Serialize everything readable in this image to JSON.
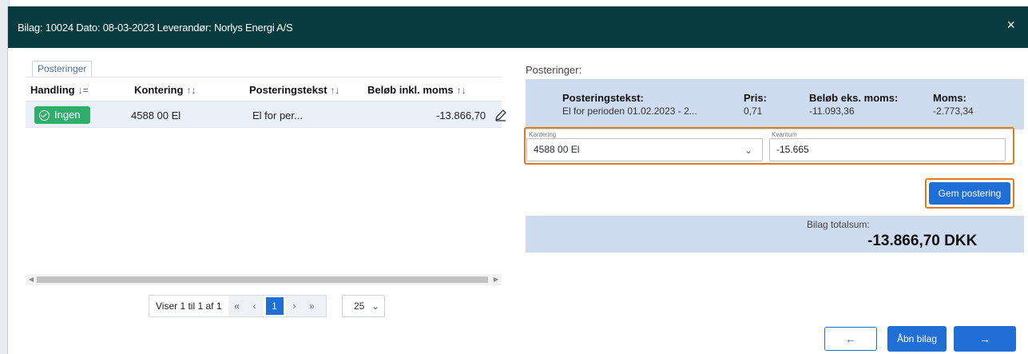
{
  "header": {
    "title": "Bilag: 10024 Dato: 08-03-2023 Leverandør: Norlys Energi A/S",
    "close_glyph": "×"
  },
  "left": {
    "tab_label": "Posteringer",
    "columns": {
      "handling": "Handling",
      "handling_sort": "↓=",
      "kontering": "Kontering",
      "kontering_sort": "↑↓",
      "posteringstekst": "Posteringstekst",
      "posteringstekst_sort": "↑↓",
      "belob": "Beløb inkl. moms",
      "belob_sort": "↑↓"
    },
    "rows": [
      {
        "status": "Ingen",
        "kontering": "4588 00 El",
        "posteringstekst": "El for per...",
        "belob": "-13.866,70"
      }
    ],
    "pager": {
      "info": "Viser 1 til 1 af 1",
      "first": "«",
      "prev": "‹",
      "current": "1",
      "next": "›",
      "last": "»",
      "page_size": "25"
    }
  },
  "right": {
    "title": "Posteringer:",
    "summary": {
      "posteringstekst_label": "Posteringstekst:",
      "posteringstekst_value": "El for perioden 01.02.2023 - 2...",
      "pris_label": "Pris:",
      "pris_value": "0,71",
      "belob_eks_label": "Beløb eks. moms:",
      "belob_eks_value": "-11.093,36",
      "moms_label": "Moms:",
      "moms_value": "-2.773,34"
    },
    "form": {
      "kontering_label": "Kontering",
      "kontering_value": "4588 00 El",
      "kvantum_label": "Kvantum",
      "kvantum_value": "-15.665"
    },
    "save_label": "Gem postering",
    "total_label": "Bilag totalsum:",
    "total_value": "-13.866,70 DKK"
  },
  "footer": {
    "prev_glyph": "←",
    "open_label": "Åbn bilag",
    "next_glyph": "→"
  },
  "colors": {
    "header_bg": "#063b40",
    "accent_blue": "#1f6fd6",
    "status_green": "#2fae6b",
    "panel_blue": "#cfdcef",
    "highlight_orange": "#e07a1f"
  }
}
